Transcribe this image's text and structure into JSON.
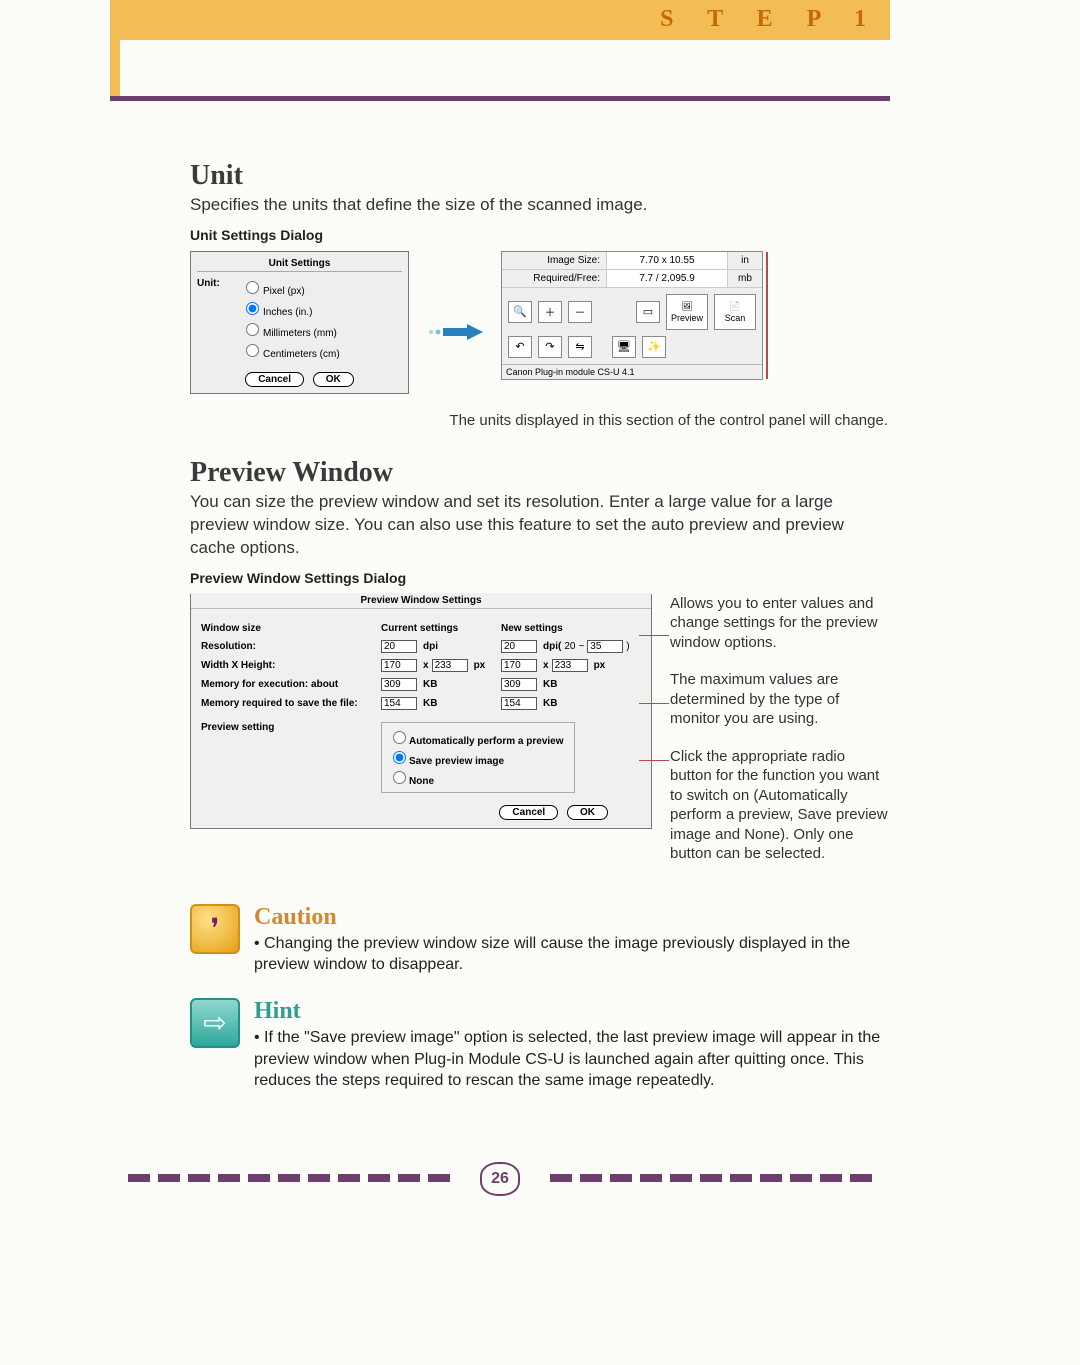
{
  "header": {
    "step_label": "S T E P   1"
  },
  "unit": {
    "heading": "Unit",
    "body": "Specifies the units that define the size of the scanned image.",
    "subheading": "Unit Settings Dialog",
    "dialog": {
      "title": "Unit Settings",
      "label": "Unit:",
      "options": {
        "px": "Pixel (px)",
        "in": "Inches (in.)",
        "mm": "Millimeters (mm)",
        "cm": "Centimeters (cm)"
      },
      "selected": "in",
      "cancel": "Cancel",
      "ok": "OK"
    },
    "panel": {
      "image_size_label": "Image Size:",
      "image_size_value": "7.70  x  10.55",
      "image_size_unit": "in",
      "required_label": "Required/Free:",
      "required_value": "7.7 / 2,095.9",
      "required_unit": "mb",
      "preview_btn": "Preview",
      "scan_btn": "Scan",
      "status": "Canon Plug-in module CS-U 4.1"
    },
    "caption": "The units displayed in this section of the control panel will change."
  },
  "preview": {
    "heading": "Preview Window",
    "body": "You can size the preview window and set its resolution. Enter a large value for a large preview window size. You can also use this feature to set the auto preview and preview cache options.",
    "subheading": "Preview Window Settings Dialog",
    "dialog": {
      "title": "Preview Window Settings",
      "window_size": "Window size",
      "current": "Current settings",
      "new": "New settings",
      "rows": {
        "resolution": {
          "label": "Resolution:",
          "cur": "20",
          "cur_unit": "dpi",
          "new": "20",
          "new_unit": "dpi(",
          "new_range_lo": "20",
          "new_tilde": "~",
          "new_range_hi": "35",
          "new_close": ")"
        },
        "wxh": {
          "label": "Width X Height:",
          "cur_w": "170",
          "cur_x": "x",
          "cur_h": "233",
          "cur_unit": "px",
          "new_w": "170",
          "new_x": "x",
          "new_h": "233",
          "new_unit": "px"
        },
        "mem_exec": {
          "label": "Memory for execution: about",
          "cur": "309",
          "cur_unit": "KB",
          "new": "309",
          "new_unit": "KB"
        },
        "mem_save": {
          "label": "Memory required to save the file:",
          "cur": "154",
          "cur_unit": "KB",
          "new": "154",
          "new_unit": "KB"
        }
      },
      "setting_label": "Preview setting",
      "setting_options": {
        "auto": "Automatically perform a preview",
        "save": "Save preview image",
        "none": "None"
      },
      "setting_selected": "save",
      "cancel": "Cancel",
      "ok": "OK"
    },
    "notes": {
      "n1": "Allows you to enter values and change settings for the preview window options.",
      "n2": "The maximum values are determined by the type of monitor you are using.",
      "n3": "Click the appropriate radio button for the function you want to switch on (Automatically perform a preview, Save preview image and None). Only one button can be selected."
    }
  },
  "caution": {
    "heading": "Caution",
    "text": "• Changing the preview window size will cause the image previously displayed in the preview window to disappear."
  },
  "hint": {
    "heading": "Hint",
    "text": "• If the \"Save preview image\" option is selected, the last preview image will appear in the preview window when Plug-in Module CS-U is launched again after quitting once. This reduces the steps required to rescan the same image repeatedly."
  },
  "page_number": "26"
}
